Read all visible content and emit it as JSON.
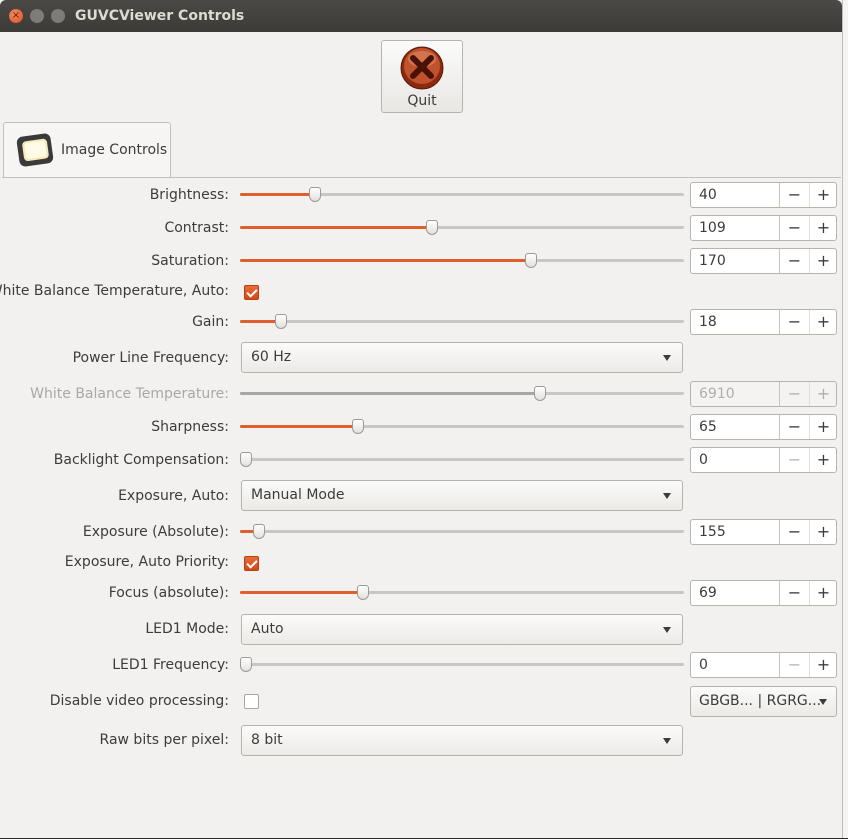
{
  "window": {
    "title": "GUVCViewer Controls"
  },
  "toolbar": {
    "quit_label": "Quit"
  },
  "tabs": [
    {
      "label": "Image Controls"
    }
  ],
  "colors": {
    "accent": "#e05f2c",
    "titlebar": "#3c3b37",
    "background": "#f2f1f0"
  },
  "controls": {
    "brightness": {
      "label": "Brightness:",
      "value": "40",
      "level": 0.16
    },
    "contrast": {
      "label": "Contrast:",
      "value": "109",
      "level": 0.43
    },
    "saturation": {
      "label": "Saturation:",
      "value": "170",
      "level": 0.66
    },
    "wb_auto": {
      "label": "White Balance Temperature, Auto:",
      "checked": true
    },
    "gain": {
      "label": "Gain:",
      "value": "18",
      "level": 0.08
    },
    "power_line": {
      "label": "Power Line Frequency:",
      "selected": "60 Hz"
    },
    "wb_temp": {
      "label": "White Balance Temperature:",
      "value": "6910",
      "level": 0.68,
      "disabled": true
    },
    "sharpness": {
      "label": "Sharpness:",
      "value": "65",
      "level": 0.26
    },
    "backlight": {
      "label": "Backlight Compensation:",
      "value": "0",
      "level": 0.0
    },
    "exposure_auto": {
      "label": "Exposure, Auto:",
      "selected": "Manual Mode"
    },
    "exposure_abs": {
      "label": "Exposure (Absolute):",
      "value": "155",
      "level": 0.03
    },
    "exposure_priority": {
      "label": "Exposure, Auto Priority:",
      "checked": true
    },
    "focus": {
      "label": "Focus (absolute):",
      "value": "69",
      "level": 0.27
    },
    "led1_mode": {
      "label": "LED1 Mode:",
      "selected": "Auto"
    },
    "led1_freq": {
      "label": "LED1 Frequency:",
      "value": "0",
      "level": 0.0
    },
    "disable_video": {
      "label": "Disable video processing:",
      "checked": false,
      "bayer_selected": "GBGB... | RGRG..."
    },
    "raw_bits": {
      "label": "Raw bits per pixel:",
      "selected": "8 bit"
    }
  },
  "icons": {
    "quit": "stop-x-icon",
    "tab": "camera-screen-icon",
    "minus": "−",
    "plus": "+"
  }
}
